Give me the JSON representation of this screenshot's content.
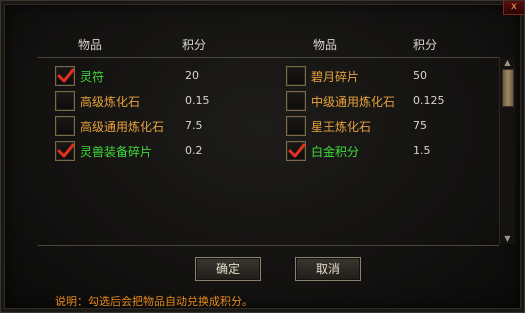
{
  "close_button": "x",
  "headers": {
    "left_item": "物品",
    "left_score": "积分",
    "right_item": "物品",
    "right_score": "积分"
  },
  "colors": {
    "checked_text": "#3ede3a",
    "unchecked_text": "#e7a23a",
    "checkmark": "#e0301e"
  },
  "left_items": [
    {
      "name": "灵符",
      "score": "20",
      "checked": true
    },
    {
      "name": "高级炼化石",
      "score": "0.15",
      "checked": false
    },
    {
      "name": "高级通用炼化石",
      "score": "7.5",
      "checked": false
    },
    {
      "name": "灵兽装备碎片",
      "score": "0.2",
      "checked": true
    }
  ],
  "right_items": [
    {
      "name": "碧月碎片",
      "score": "50",
      "checked": false
    },
    {
      "name": "中级通用炼化石",
      "score": "0.125",
      "checked": false
    },
    {
      "name": "星王炼化石",
      "score": "75",
      "checked": false
    },
    {
      "name": "白金积分",
      "score": "1.5",
      "checked": true
    }
  ],
  "buttons": {
    "confirm": "确定",
    "cancel": "取消"
  },
  "note": "说明：勾选后会把物品自动兑换成积分。"
}
